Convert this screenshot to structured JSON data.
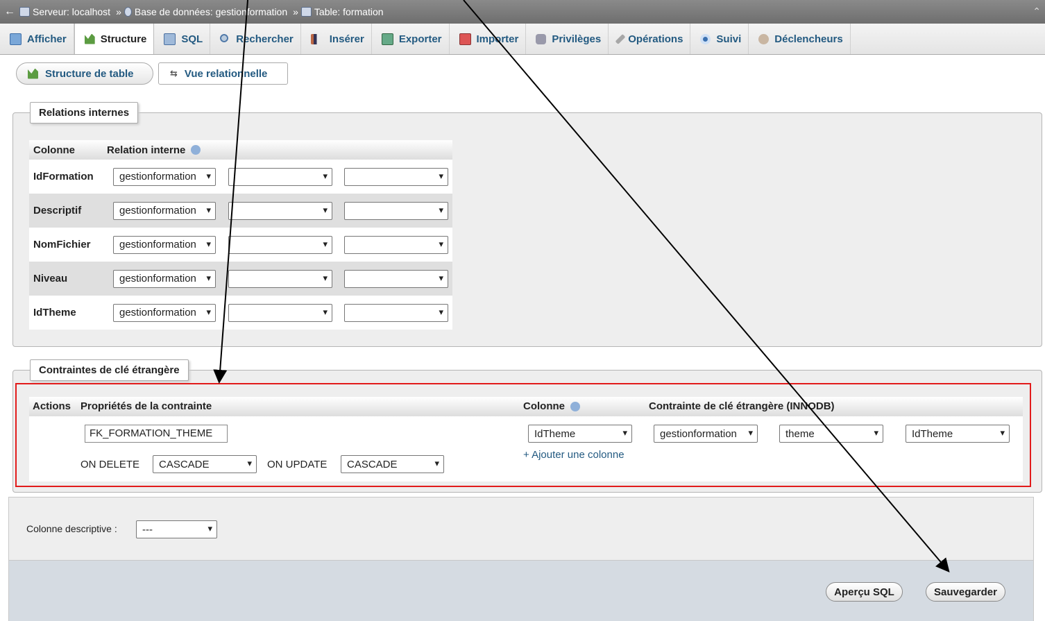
{
  "breadcrumb": {
    "server": "Serveur: localhost",
    "database": "Base de données: gestionformation",
    "table": "Table: formation",
    "separator": "»"
  },
  "tabs": [
    {
      "label": "Afficher",
      "icon": "browse-icon"
    },
    {
      "label": "Structure",
      "icon": "structure-icon",
      "active": true
    },
    {
      "label": "SQL",
      "icon": "sql-icon"
    },
    {
      "label": "Rechercher",
      "icon": "search-icon"
    },
    {
      "label": "Insérer",
      "icon": "insert-icon"
    },
    {
      "label": "Exporter",
      "icon": "export-icon"
    },
    {
      "label": "Importer",
      "icon": "import-icon"
    },
    {
      "label": "Privilèges",
      "icon": "privileges-icon"
    },
    {
      "label": "Opérations",
      "icon": "operations-icon"
    },
    {
      "label": "Suivi",
      "icon": "tracking-icon"
    },
    {
      "label": "Déclencheurs",
      "icon": "triggers-icon"
    }
  ],
  "subtabs": {
    "table_structure": "Structure de table",
    "relational_view": "Vue relationnelle"
  },
  "internal": {
    "legend": "Relations internes",
    "col_header": "Colonne",
    "rel_header": "Relation interne",
    "rows": [
      {
        "column": "IdFormation",
        "db": "gestionformation"
      },
      {
        "column": "Descriptif",
        "db": "gestionformation"
      },
      {
        "column": "NomFichier",
        "db": "gestionformation"
      },
      {
        "column": "Niveau",
        "db": "gestionformation"
      },
      {
        "column": "IdTheme",
        "db": "gestionformation"
      }
    ]
  },
  "fk": {
    "legend": "Contraintes de clé étrangère",
    "h_actions": "Actions",
    "h_props": "Propriétés de la contrainte",
    "h_column": "Colonne",
    "h_constraint": "Contrainte de clé étrangère (INNODB)",
    "name": "FK_FORMATION_THEME",
    "on_delete_label": "ON DELETE",
    "on_delete": "CASCADE",
    "on_update_label": "ON UPDATE",
    "on_update": "CASCADE",
    "column": "IdTheme",
    "add_column": "+ Ajouter une colonne",
    "ref_db": "gestionformation",
    "ref_table": "theme",
    "ref_column": "IdTheme"
  },
  "display": {
    "label": "Colonne descriptive :",
    "value": "---"
  },
  "buttons": {
    "preview_sql": "Aperçu SQL",
    "save": "Sauvegarder"
  },
  "annotation_color": "#e21b1b"
}
